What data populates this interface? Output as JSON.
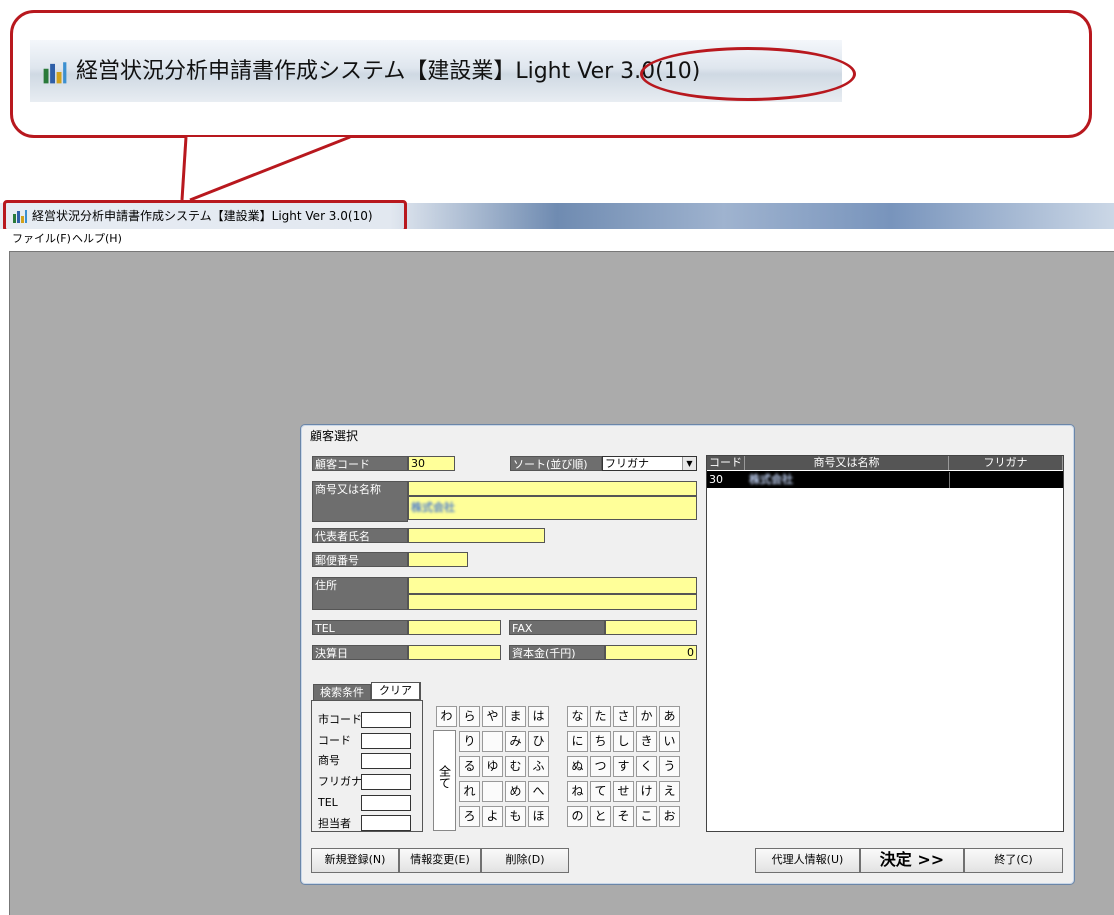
{
  "callout": {
    "title": "経営状況分析申請書作成システム【建設業】Light Ver 3.0(10)"
  },
  "window": {
    "title": "経営状況分析申請書作成システム【建設業】Light Ver 3.0(10)",
    "menu": [
      "ファイル(F)",
      "ヘルプ(H)"
    ]
  },
  "dialog": {
    "title": "顧客選択",
    "customer_code_label": "顧客コード",
    "customer_code_value": "30",
    "sort_label": "ソート(並び順)",
    "sort_value": "フリガナ",
    "trade_name_label": "商号又は名称",
    "trade_name_value": "株式会社",
    "representative_label": "代表者氏名",
    "postal_label": "郵便番号",
    "address_label": "住所",
    "tel_label": "TEL",
    "fax_label": "FAX",
    "settlement_label": "決算日",
    "capital_label": "資本金(千円)",
    "capital_value": "0"
  },
  "list": {
    "columns": [
      "コード",
      "商号又は名称",
      "フリガナ"
    ],
    "rows": [
      {
        "code": "30",
        "name": "株式会社",
        "kana": ""
      }
    ]
  },
  "search": {
    "tab_label": "検索条件",
    "clear_label": "クリア",
    "fields": [
      "市コード",
      "コード",
      "商号",
      "フリガナ",
      "TEL",
      "担当者"
    ]
  },
  "kana": {
    "all_label": "全て",
    "rows": [
      [
        "わ",
        "ら",
        "や",
        "ま",
        "は",
        "な",
        "た",
        "さ",
        "か",
        "あ"
      ],
      [
        "",
        "り",
        "",
        "み",
        "ひ",
        "に",
        "ち",
        "し",
        "き",
        "い"
      ],
      [
        "",
        "る",
        "ゆ",
        "む",
        "ふ",
        "ぬ",
        "つ",
        "す",
        "く",
        "う"
      ],
      [
        "",
        "れ",
        "",
        "め",
        "へ",
        "ね",
        "て",
        "せ",
        "け",
        "え"
      ],
      [
        "",
        "ろ",
        "よ",
        "も",
        "ほ",
        "の",
        "と",
        "そ",
        "こ",
        "お"
      ]
    ]
  },
  "buttons": {
    "new": "新規登録(N)",
    "edit": "情報変更(E)",
    "delete": "削除(D)",
    "agent": "代理人情報(U)",
    "decide": "決定 >>",
    "exit": "終了(C)"
  },
  "colors": {
    "accent_red": "#b8181e",
    "field_yellow": "#ffff99",
    "client_gray": "#ababab"
  }
}
